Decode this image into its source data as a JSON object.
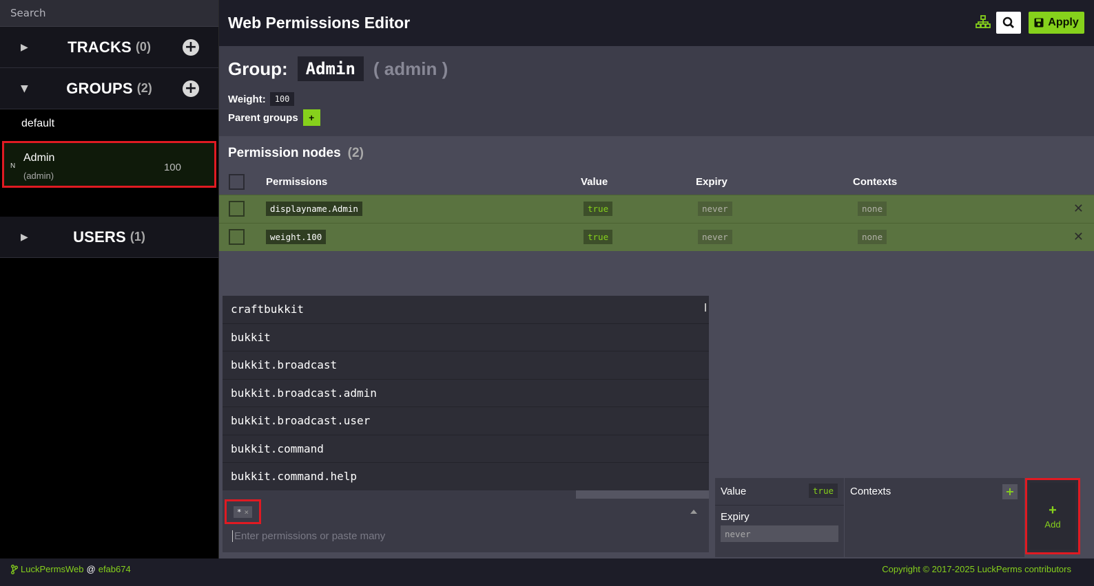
{
  "sidebar": {
    "search_placeholder": "Search",
    "tracks": {
      "title": "TRACKS",
      "count": "(0)"
    },
    "groups": {
      "title": "GROUPS",
      "count": "(2)"
    },
    "users": {
      "title": "USERS",
      "count": "(1)"
    },
    "group_items": [
      {
        "name": "default"
      },
      {
        "prefix": "N",
        "name": "Admin",
        "display": "(admin)",
        "weight": "100"
      }
    ]
  },
  "header": {
    "title": "Web Permissions Editor",
    "apply_label": "Apply"
  },
  "group": {
    "label": "Group:",
    "name": "Admin",
    "display_name": "( admin )",
    "weight_label": "Weight:",
    "weight": "100",
    "parent_groups_label": "Parent groups",
    "parent_add": "+"
  },
  "permissions": {
    "title": "Permission nodes",
    "count": "(2)",
    "columns": [
      "Permissions",
      "Value",
      "Expiry",
      "Contexts"
    ],
    "rows": [
      {
        "permission": "displayname.Admin",
        "value": "true",
        "expiry": "never",
        "contexts": "none"
      },
      {
        "permission": "weight.100",
        "value": "true",
        "expiry": "never",
        "contexts": "none"
      }
    ]
  },
  "suggestions": [
    "craftbukkit",
    "bukkit",
    "bukkit.broadcast",
    "bukkit.broadcast.admin",
    "bukkit.broadcast.user",
    "bukkit.command",
    "bukkit.command.help"
  ],
  "add_form": {
    "chip": "*",
    "chip_remove": "×",
    "input_placeholder": "Enter permissions or paste many",
    "value_label": "Value",
    "value": "true",
    "expiry_label": "Expiry",
    "expiry_value": "never",
    "contexts_label": "Contexts",
    "contexts_add": "+",
    "add_icon": "+",
    "add_label": "Add"
  },
  "footer": {
    "app": "LuckPermsWeb",
    "at": "@",
    "commit": "efab674",
    "copyright": "Copyright © 2017-2025 LuckPerms contributors"
  },
  "icons": {
    "branch": "git-branch-icon",
    "tree": "sitemap-icon",
    "search": "search-icon",
    "save": "save-icon",
    "delete": "close-icon"
  },
  "colors": {
    "accent": "#86d11c",
    "highlight": "#e01a22",
    "row_bg": "#5a7340"
  }
}
